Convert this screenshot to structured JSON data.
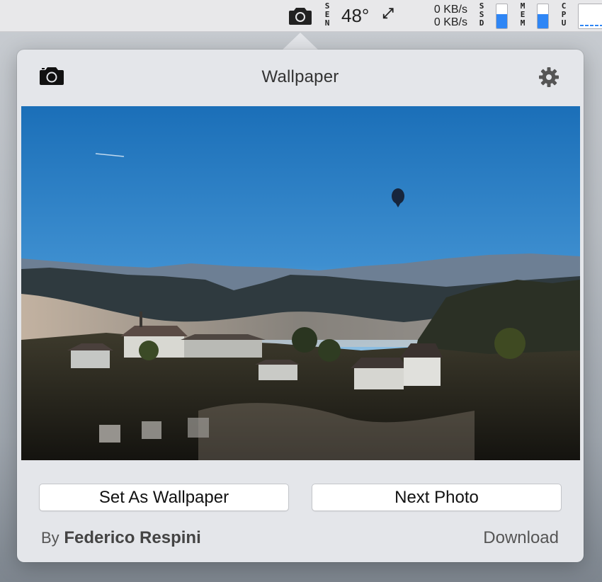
{
  "menubar": {
    "camera_icon": "camera-icon",
    "sensor_label": [
      "S",
      "E",
      "N"
    ],
    "temperature": "48°",
    "network_icon": "network-arrows-icon",
    "net_upload": "0 KB/s",
    "net_download": "0 KB/s",
    "ssd_label": [
      "S",
      "S",
      "D"
    ],
    "ssd_level": 0.6,
    "mem_label": [
      "M",
      "E",
      "M"
    ],
    "mem_level": 0.6,
    "cpu_label": [
      "C",
      "P",
      "U"
    ],
    "accent_color": "#2f86f5"
  },
  "popover": {
    "title": "Wallpaper",
    "camera_icon": "camera-icon",
    "settings_icon": "gear-icon",
    "photo_description_icon": "landscape-photo",
    "set_wallpaper_label": "Set As Wallpaper",
    "next_photo_label": "Next Photo",
    "credit_prefix": "By",
    "credit_name": "Federico Respini",
    "download_label": "Download"
  }
}
